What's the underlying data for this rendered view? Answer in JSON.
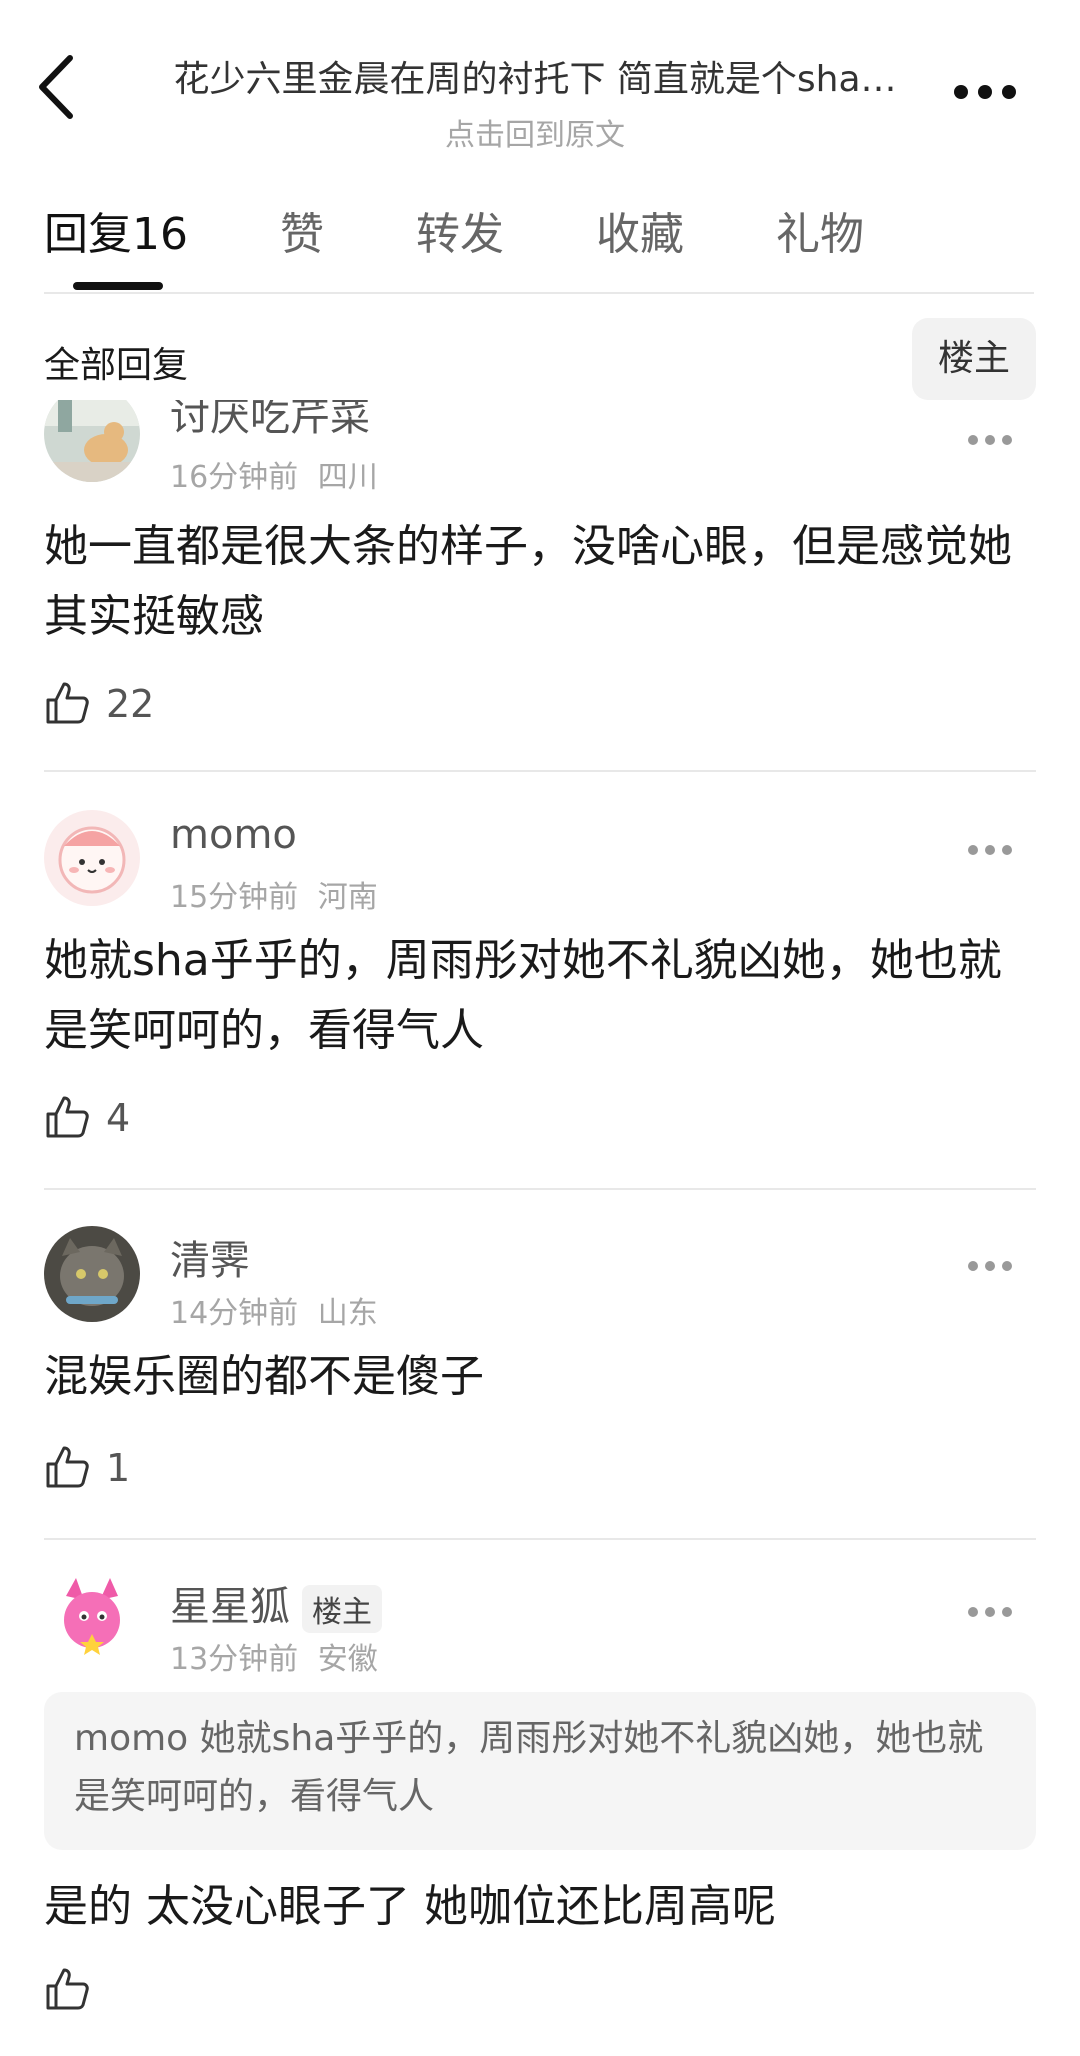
{
  "header": {
    "title": "花少六里金晨在周的衬托下 简直就是个sha…",
    "subtitle": "点击回到原文"
  },
  "tabs": [
    {
      "label": "回复16"
    },
    {
      "label": "赞"
    },
    {
      "label": "转发"
    },
    {
      "label": "收藏"
    },
    {
      "label": "礼物"
    }
  ],
  "filter": {
    "label": "全部回复",
    "op_button": "楼主"
  },
  "comments": [
    {
      "username": "讨厌吃芹菜",
      "time": "16分钟前",
      "location": "四川",
      "text": "她一直都是很大条的样子，没啥心眼，但是感觉她其实挺敏感",
      "likes": "22"
    },
    {
      "username": "momo",
      "time": "15分钟前",
      "location": "河南",
      "text": "她就sha乎乎的，周雨彤对她不礼貌凶她，她也就是笑呵呵的，看得气人",
      "likes": "4"
    },
    {
      "username": "清霁",
      "time": "14分钟前",
      "location": "山东",
      "text": "混娱乐圈的都不是傻子",
      "likes": "1"
    },
    {
      "username": "星星狐",
      "badge": "楼主",
      "time": "13分钟前",
      "location": "安徽",
      "quote": "momo 她就sha乎乎的，周雨彤对她不礼貌凶她，她也就是笑呵呵的，看得气人",
      "text": "是的 太没心眼子了 她咖位还比周高呢"
    }
  ],
  "icons": {
    "back": "chevron-left-icon",
    "more": "more-dots-icon",
    "like": "thumbs-up-icon"
  }
}
